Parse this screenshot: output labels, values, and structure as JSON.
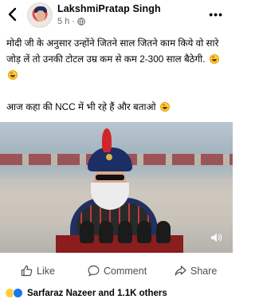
{
  "post": {
    "author": "LakshmiPratap Singh",
    "time": "5 h",
    "separator": "·",
    "more": "•••",
    "text_line1": "मोदी जी के अनुसार उन्होंने जितने साल जितने काम किये वो सारे जोड़ लें तो उनकी टोटल उम्र कम से कम 2-300 साल बैठेगी.",
    "text_line2": "आज कहा की NCC में भी रहे हैं और बताओ"
  },
  "actions": {
    "like": "Like",
    "comment": "Comment",
    "share": "Share"
  },
  "reactions": {
    "summary": "Sarfaraz Nazeer and 1.1K others"
  },
  "icons": {
    "back": "chevron-left-icon",
    "globe": "globe-icon",
    "mute": "speaker-muted-icon",
    "like": "thumbs-up-icon",
    "comment": "speech-bubble-icon",
    "share": "share-arrow-icon"
  },
  "colors": {
    "secondary_text": "#65676b",
    "action_text": "#4b4f56",
    "like_blue": "#1877f2",
    "haha_yellow": "#ffcc3d"
  }
}
